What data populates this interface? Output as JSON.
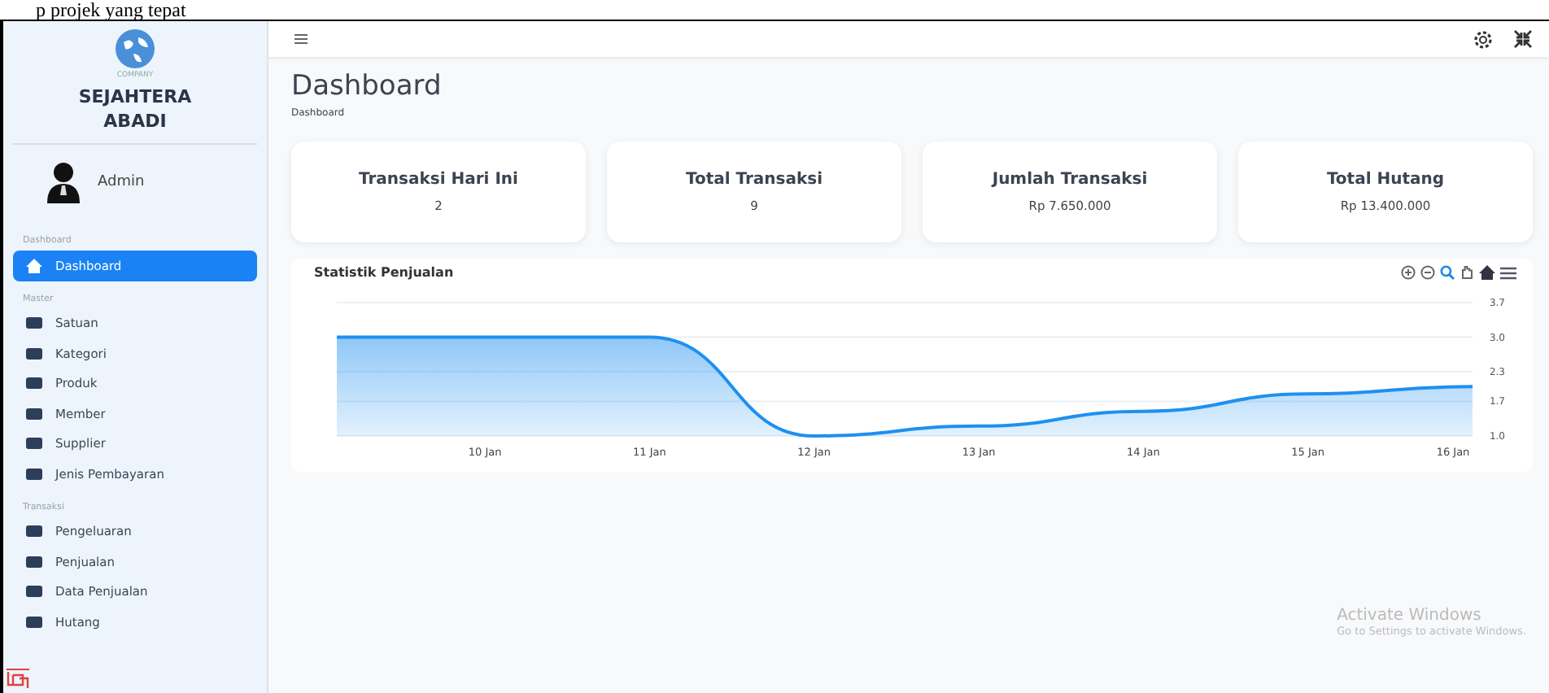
{
  "document_text": "p projek yang tepat",
  "sidebar": {
    "logo_caption": "COMPANY",
    "company": "SEJAHTERA ABADI",
    "user": "Admin",
    "sections": [
      {
        "label": "Dashboard",
        "items": [
          {
            "label": "Dashboard",
            "selected": true
          }
        ]
      },
      {
        "label": "Master",
        "items": [
          {
            "label": "Satuan",
            "selected": false
          },
          {
            "label": "Kategori",
            "selected": false
          },
          {
            "label": "Produk",
            "selected": false
          },
          {
            "label": "Member",
            "selected": false
          },
          {
            "label": "Supplier",
            "selected": false
          },
          {
            "label": "Jenis Pembayaran",
            "selected": false
          }
        ]
      },
      {
        "label": "Transaksi",
        "items": [
          {
            "label": "Pengeluaran",
            "selected": false
          },
          {
            "label": "Penjualan",
            "selected": false
          },
          {
            "label": "Data Penjualan",
            "selected": false
          },
          {
            "label": "Hutang",
            "selected": false
          }
        ]
      }
    ]
  },
  "page": {
    "title": "Dashboard",
    "breadcrumb": "Dashboard"
  },
  "stats": [
    {
      "label": "Transaksi Hari Ini",
      "value": "2"
    },
    {
      "label": "Total Transaksi",
      "value": "9"
    },
    {
      "label": "Jumlah Transaksi",
      "value": "Rp 7.650.000"
    },
    {
      "label": "Total Hutang",
      "value": "Rp 13.400.000"
    }
  ],
  "chart": {
    "title": "Statistik Penjualan",
    "chart_data": {
      "type": "area",
      "grid": true,
      "categories": [
        null,
        "10 Jan",
        "11 Jan",
        "12 Jan",
        "13 Jan",
        "14 Jan",
        "15 Jan",
        "16 Jan"
      ],
      "series": [
        {
          "color": "#1e90f0",
          "values": [
            3.0,
            3.0,
            3.0,
            1.0,
            1.2,
            1.5,
            1.85,
            2.0
          ]
        }
      ],
      "ylim": [
        1.0,
        3.7
      ],
      "yticks": [
        {
          "value": 1.0,
          "label": "1.0"
        },
        {
          "value": 1.7,
          "label": "1.7"
        },
        {
          "value": 2.3,
          "label": "2.3"
        },
        {
          "value": 3.0,
          "label": "3.0"
        },
        {
          "value": 3.7,
          "label": "3.7"
        }
      ]
    }
  },
  "watermark": {
    "title": "Activate Windows",
    "subtitle": "Go to Settings to activate Windows."
  }
}
